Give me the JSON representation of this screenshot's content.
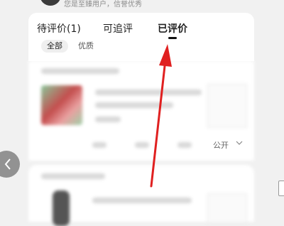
{
  "profile": {
    "description": "您是至臻用户，信誉优秀"
  },
  "tabs": [
    {
      "label": "待评价(1)",
      "active": false
    },
    {
      "label": "可追评",
      "active": false
    },
    {
      "label": "已评价",
      "active": true
    }
  ],
  "filters": [
    {
      "label": "全部",
      "selected": true
    },
    {
      "label": "优质",
      "selected": false
    }
  ],
  "review_item": {
    "visibility_text": "公开"
  },
  "icons": {
    "back": "chevron-left-icon",
    "visibility_dropdown": "chevron-down-icon"
  },
  "colors": {
    "annotation_arrow": "#e02020",
    "active_indicator": "#111111"
  }
}
